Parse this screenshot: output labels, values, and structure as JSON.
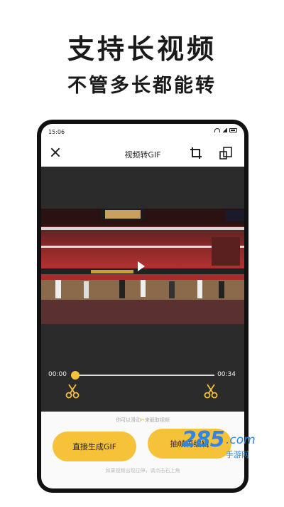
{
  "promo": {
    "headline": "支持长视频",
    "subline": "不管多长都能转"
  },
  "status_bar": {
    "time": "15:06"
  },
  "app_bar": {
    "title": "视频转GIF"
  },
  "player": {
    "start_time": "00:00",
    "end_time": "00:34"
  },
  "bottom": {
    "hint_top_before": "你可以滑动",
    "hint_top_after": "来截取视频",
    "direct_button": "直接生成GIF",
    "frame_button": "抽帧再编辑",
    "hint_bottom": "如果视频出现拉伸，请点击右上角"
  },
  "watermark": {
    "number": "285",
    "domain": ".com",
    "sub": "手游网"
  },
  "colors": {
    "accent": "#f5c23a",
    "dark_bg": "#2b2b2b",
    "watermark": "#2e86de"
  }
}
